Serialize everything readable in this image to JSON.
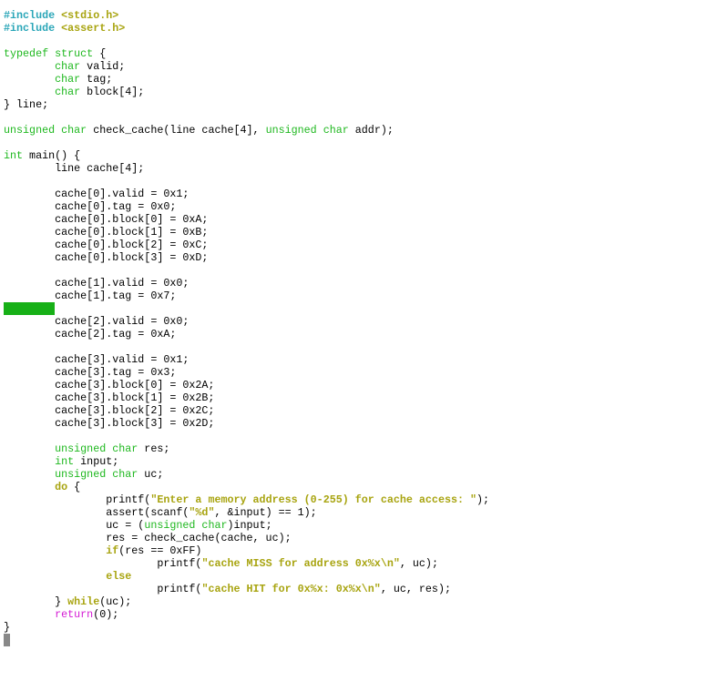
{
  "editor": {
    "lines": [
      [
        [
          "#include ",
          "p"
        ],
        [
          "<stdio.h>",
          "s"
        ]
      ],
      [
        [
          "#include ",
          "p"
        ],
        [
          "<assert.h>",
          "s"
        ]
      ],
      [],
      [
        [
          "typedef struct",
          "t"
        ],
        [
          " {",
          "n"
        ]
      ],
      [
        [
          "        ",
          "n"
        ],
        [
          "char",
          "t"
        ],
        [
          " valid;",
          "n"
        ]
      ],
      [
        [
          "        ",
          "n"
        ],
        [
          "char",
          "t"
        ],
        [
          " tag;",
          "n"
        ]
      ],
      [
        [
          "        ",
          "n"
        ],
        [
          "char",
          "t"
        ],
        [
          " block[4];",
          "n"
        ]
      ],
      [
        [
          "} line;",
          "n"
        ]
      ],
      [],
      [
        [
          "unsigned char",
          "t"
        ],
        [
          " check_cache(line cache[4], ",
          "n"
        ],
        [
          "unsigned char",
          "t"
        ],
        [
          " addr);",
          "n"
        ]
      ],
      [],
      [
        [
          "int",
          "t"
        ],
        [
          " main() {",
          "n"
        ]
      ],
      [
        [
          "        line cache[4];",
          "n"
        ]
      ],
      [],
      [
        [
          "        cache[0].valid = 0x1;",
          "n"
        ]
      ],
      [
        [
          "        cache[0].tag = 0x0;",
          "n"
        ]
      ],
      [
        [
          "        cache[0].block[0] = 0xA;",
          "n"
        ]
      ],
      [
        [
          "        cache[0].block[1] = 0xB;",
          "n"
        ]
      ],
      [
        [
          "        cache[0].block[2] = 0xC;",
          "n"
        ]
      ],
      [
        [
          "        cache[0].block[3] = 0xD;",
          "n"
        ]
      ],
      [],
      [
        [
          "        cache[1].valid = 0x0;",
          "n"
        ]
      ],
      [
        [
          "        cache[1].tag = 0x7;",
          "n"
        ]
      ],
      [
        [
          "",
          "hl"
        ]
      ],
      [
        [
          "        cache[2].valid = 0x0;",
          "n"
        ]
      ],
      [
        [
          "        cache[2].tag = 0xA;",
          "n"
        ]
      ],
      [],
      [
        [
          "        cache[3].valid = 0x1;",
          "n"
        ]
      ],
      [
        [
          "        cache[3].tag = 0x3;",
          "n"
        ]
      ],
      [
        [
          "        cache[3].block[0] = 0x2A;",
          "n"
        ]
      ],
      [
        [
          "        cache[3].block[1] = 0x2B;",
          "n"
        ]
      ],
      [
        [
          "        cache[3].block[2] = 0x2C;",
          "n"
        ]
      ],
      [
        [
          "        cache[3].block[3] = 0x2D;",
          "n"
        ]
      ],
      [],
      [
        [
          "        ",
          "n"
        ],
        [
          "unsigned char",
          "t"
        ],
        [
          " res;",
          "n"
        ]
      ],
      [
        [
          "        ",
          "n"
        ],
        [
          "int",
          "t"
        ],
        [
          " input;",
          "n"
        ]
      ],
      [
        [
          "        ",
          "n"
        ],
        [
          "unsigned char",
          "t"
        ],
        [
          " uc;",
          "n"
        ]
      ],
      [
        [
          "        ",
          "n"
        ],
        [
          "do",
          "k"
        ],
        [
          " {",
          "n"
        ]
      ],
      [
        [
          "                printf(",
          "n"
        ],
        [
          "\"Enter a memory address (0-255) for cache access: \"",
          "s"
        ],
        [
          ");",
          "n"
        ]
      ],
      [
        [
          "                assert(scanf(",
          "n"
        ],
        [
          "\"%d\"",
          "s"
        ],
        [
          ", &input) == 1);",
          "n"
        ]
      ],
      [
        [
          "                uc = (",
          "n"
        ],
        [
          "unsigned char",
          "t"
        ],
        [
          ")input;",
          "n"
        ]
      ],
      [
        [
          "                res = check_cache(cache, uc);",
          "n"
        ]
      ],
      [
        [
          "                ",
          "n"
        ],
        [
          "if",
          "k"
        ],
        [
          "(res == 0xFF)",
          "n"
        ]
      ],
      [
        [
          "                        printf(",
          "n"
        ],
        [
          "\"cache MISS for address 0x%x\\n\"",
          "s"
        ],
        [
          ", uc);",
          "n"
        ]
      ],
      [
        [
          "                ",
          "n"
        ],
        [
          "else",
          "k"
        ]
      ],
      [
        [
          "                        printf(",
          "n"
        ],
        [
          "\"cache HIT for 0x%x: 0x%x\\n\"",
          "s"
        ],
        [
          ", uc, res);",
          "n"
        ]
      ],
      [
        [
          "        } ",
          "n"
        ],
        [
          "while",
          "k"
        ],
        [
          "(uc);",
          "n"
        ]
      ],
      [
        [
          "        ",
          "n"
        ],
        [
          "return",
          "r"
        ],
        [
          "(0);",
          "n"
        ]
      ],
      [
        [
          "}",
          "n"
        ]
      ],
      [
        [
          "",
          "cur"
        ]
      ]
    ]
  }
}
